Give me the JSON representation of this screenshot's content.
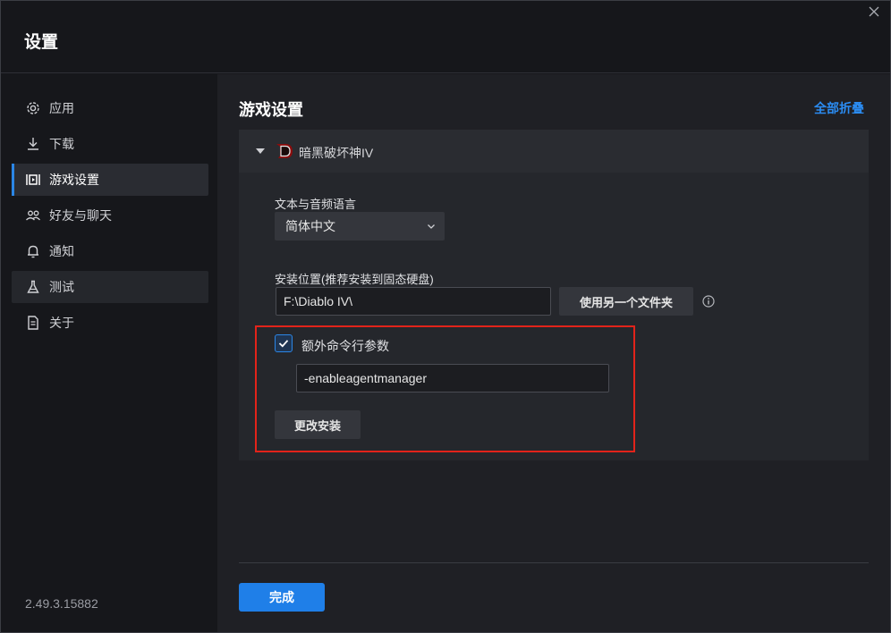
{
  "window": {
    "title": "设置"
  },
  "sidebar": {
    "items": [
      {
        "label": "应用",
        "icon": "gear-icon"
      },
      {
        "label": "下载",
        "icon": "download-icon"
      },
      {
        "label": "游戏设置",
        "icon": "game-settings-icon",
        "active": true
      },
      {
        "label": "好友与聊天",
        "icon": "friends-icon"
      },
      {
        "label": "通知",
        "icon": "bell-icon"
      },
      {
        "label": "测试",
        "icon": "flask-icon"
      },
      {
        "label": "关于",
        "icon": "document-icon"
      }
    ],
    "version": "2.49.3.15882"
  },
  "main": {
    "title": "游戏设置",
    "collapse_all": "全部折叠",
    "game": {
      "name": "暗黑破坏神IV",
      "language_label": "文本与音频语言",
      "language_value": "简体中文",
      "install_label": "安装位置(推荐安装到固态硬盘)",
      "install_path": "F:\\Diablo IV\\",
      "browse_button": "使用另一个文件夹",
      "extra_args_label": "额外命令行参数",
      "extra_args_checked": true,
      "extra_args_value": "-enableagentmanager",
      "change_install_button": "更改安装"
    },
    "done_button": "完成"
  },
  "colors": {
    "accent": "#1f7fe8",
    "highlight": "#e2231a",
    "link": "#2b8cf2"
  }
}
